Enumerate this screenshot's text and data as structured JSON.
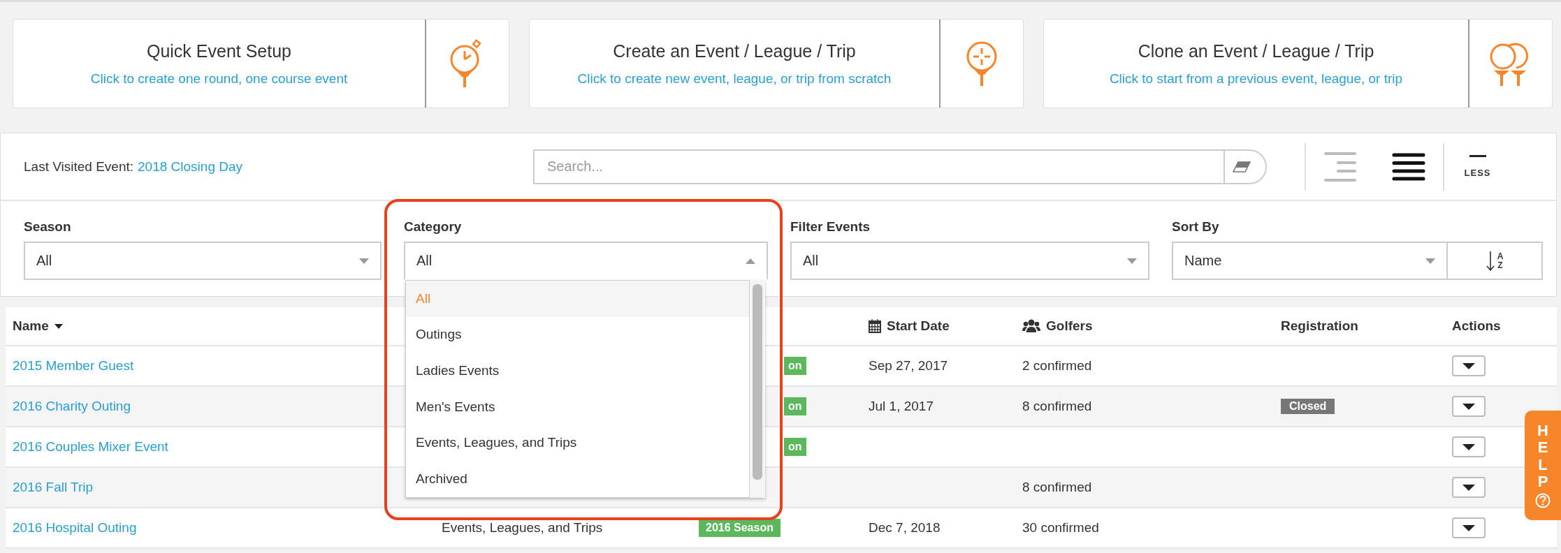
{
  "action_cards": [
    {
      "kind": "stopwatch",
      "title": "Quick Event Setup",
      "subtitle": "Click to create one round, one course event"
    },
    {
      "kind": "plus",
      "title": "Create an Event / League / Trip",
      "subtitle": "Click to create new event, league, or trip from scratch"
    },
    {
      "kind": "double",
      "title": "Clone an Event / League / Trip",
      "subtitle": "Click to start from a previous event, league, or trip"
    }
  ],
  "last_visited": {
    "label": "Last Visited Event:",
    "link": "2018 Closing Day"
  },
  "search": {
    "placeholder": "Search..."
  },
  "view_toggles": [
    {
      "kind": "compact",
      "selected": false
    },
    {
      "kind": "comfortable",
      "selected": true
    }
  ],
  "less_button": {
    "label": "LESS"
  },
  "filters": [
    {
      "label": "Season",
      "value": "All",
      "expanded": false
    },
    {
      "label": "Category",
      "value": "All",
      "expanded": true,
      "options": [
        {
          "label": "All",
          "selected": true
        },
        {
          "label": "Outings",
          "selected": false
        },
        {
          "label": "Ladies Events",
          "selected": false
        },
        {
          "label": "Men's Events",
          "selected": false
        },
        {
          "label": "Events, Leagues, and Trips",
          "selected": false
        },
        {
          "label": "Archived",
          "selected": false
        }
      ]
    },
    {
      "label": "Filter Events",
      "value": "All",
      "expanded": false
    },
    {
      "label": "Sort By",
      "value": "Name",
      "expanded": false
    }
  ],
  "sort_direction": {
    "top": "A",
    "bottom": "Z"
  },
  "table": {
    "columns": [
      {
        "label": "Name",
        "kind": "sorted"
      },
      {
        "label": "Start Date",
        "kind": "date"
      },
      {
        "label": "Golfers",
        "kind": "people"
      },
      {
        "label": "Registration",
        "kind": "plain"
      },
      {
        "label": "Actions",
        "kind": "plain"
      }
    ],
    "rows": [
      {
        "name": "2015 Member Guest",
        "season": "on",
        "season_cut": true,
        "start_date": "Sep 27, 2017",
        "golfers": "2 confirmed"
      },
      {
        "name": "2016 Charity Outing",
        "season": "on",
        "season_cut": true,
        "start_date": "Jul 1, 2017",
        "golfers": "8 confirmed",
        "registration": "Closed"
      },
      {
        "name": "2016 Couples Mixer Event",
        "season": "on",
        "season_cut": true
      },
      {
        "name": "2016 Fall Trip",
        "golfers": "8 confirmed"
      },
      {
        "name": "2016 Hospital Outing",
        "category": "Events, Leagues, and Trips",
        "season": "2016 Season",
        "season_cut": false,
        "start_date": "Dec 7, 2018",
        "golfers": "30 confirmed"
      }
    ]
  },
  "help_tab": {
    "label": "HELP"
  }
}
